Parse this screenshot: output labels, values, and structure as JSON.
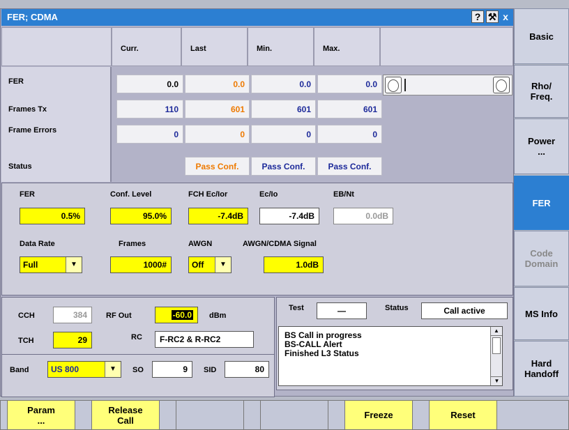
{
  "window": {
    "title": "FER; CDMA"
  },
  "table": {
    "columns": [
      "Curr.",
      "Last",
      "Min.",
      "Max."
    ],
    "rows": [
      {
        "label": "FER",
        "values": [
          "0.0",
          "0.0",
          "0.0",
          "0.0"
        ]
      },
      {
        "label": "Frames Tx",
        "values": [
          "110",
          "601",
          "601",
          "601"
        ]
      },
      {
        "label": "Frame Errors",
        "values": [
          "0",
          "0",
          "0",
          "0"
        ]
      },
      {
        "label": "Status",
        "values": [
          "",
          "Pass Conf.",
          "Pass Conf.",
          "Pass Conf."
        ]
      }
    ]
  },
  "params": {
    "fer_label": "FER",
    "fer_value": "0.5%",
    "conf_label": "Conf. Level",
    "conf_value": "95.0%",
    "fch_label": "FCH Ec/Ior",
    "fch_value": "-7.4dB",
    "ecio_label": "Ec/Io",
    "ecio_value": "-7.4dB",
    "ebnt_label": "EB/Nt",
    "ebnt_value": "0.0dB",
    "datarate_label": "Data Rate",
    "datarate_value": "Full",
    "frames_label": "Frames",
    "frames_value": "1000#",
    "awgn_label": "AWGN",
    "awgn_value": "Off",
    "awgncdma_label": "AWGN/CDMA Signal",
    "awgncdma_value": "1.0dB"
  },
  "lower": {
    "cch_label": "CCH",
    "cch_value": "384",
    "rfout_label": "RF Out",
    "rfout_value": "-60.0",
    "rfout_unit": "dBm",
    "tch_label": "TCH",
    "tch_value": "29",
    "rc_label": "RC",
    "rc_value": "F-RC2 & R-RC2",
    "band_label": "Band",
    "band_value": "US 800",
    "so_label": "SO",
    "so_value": "9",
    "sid_label": "SID",
    "sid_value": "80"
  },
  "status_panel": {
    "test_label": "Test",
    "test_value": "—",
    "status_label": "Status",
    "status_value": "Call active",
    "log": [
      "BS Call in progress",
      "BS-CALL Alert",
      "Finished L3 Status"
    ]
  },
  "side_buttons": [
    {
      "line1": "Basic",
      "line2": ""
    },
    {
      "line1": "Rho/",
      "line2": "Freq."
    },
    {
      "line1": "Power",
      "line2": "..."
    },
    {
      "line1": "FER",
      "line2": ""
    },
    {
      "line1": "Code",
      "line2": "Domain"
    },
    {
      "line1": "MS Info",
      "line2": ""
    },
    {
      "line1": "Hard",
      "line2": "Handoff"
    }
  ],
  "bottom_buttons": [
    {
      "line1": "Param",
      "line2": "..."
    },
    {
      "line1": "Release",
      "line2": "Call"
    },
    {
      "line1": "Freeze",
      "line2": ""
    },
    {
      "line1": "Reset",
      "line2": ""
    }
  ],
  "colors": {
    "title_bar": "#2c7fd2",
    "highlight_field": "#ffff00",
    "active_tab": "#2c7fd2",
    "last_column": "#ee7a00",
    "min_max_columns": "#1d2a9a"
  }
}
